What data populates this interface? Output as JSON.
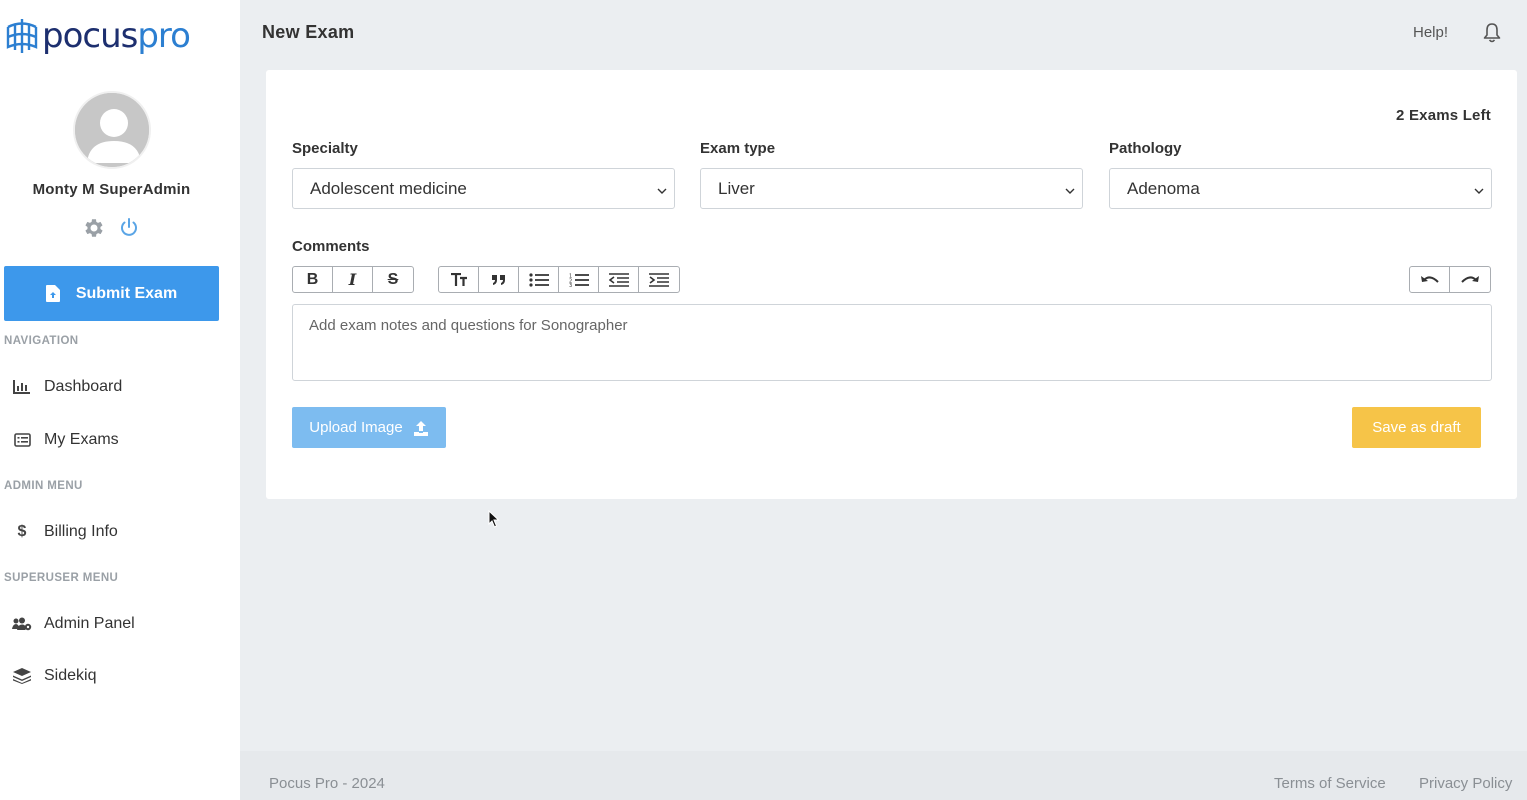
{
  "brand": {
    "logo_part1": "pocus",
    "logo_part2": "pro"
  },
  "user": {
    "name": "Monty M SuperAdmin"
  },
  "sidebar": {
    "submit_label": "Submit Exam",
    "sections": {
      "navigation": "NAVIGATION",
      "admin": "ADMIN MENU",
      "superuser": "SUPERUSER MENU"
    },
    "items": {
      "dashboard": "Dashboard",
      "my_exams": "My Exams",
      "billing": "Billing Info",
      "admin_panel": "Admin Panel",
      "sidekiq": "Sidekiq"
    }
  },
  "header": {
    "title": "New Exam",
    "help": "Help!"
  },
  "form": {
    "exams_left": "2 Exams Left",
    "specialty": {
      "label": "Specialty",
      "value": "Adolescent medicine"
    },
    "exam_type": {
      "label": "Exam type",
      "value": "Liver"
    },
    "pathology": {
      "label": "Pathology",
      "value": "Adenoma"
    },
    "comments": {
      "label": "Comments",
      "placeholder": "Add exam notes and questions for Sonographer"
    },
    "upload_label": "Upload Image",
    "draft_label": "Save as draft"
  },
  "footer": {
    "copyright": "Pocus Pro - 2024",
    "terms": "Terms of Service",
    "privacy": "Privacy Policy"
  },
  "colors": {
    "primary": "#3d98eb",
    "upload": "#7dbcf0",
    "draft": "#f6c448",
    "logo_dark": "#1d2f6f",
    "logo_light": "#2c7fd1"
  },
  "icons": [
    "logo-icon",
    "avatar-icon",
    "gear-icon",
    "power-icon",
    "file-upload-icon",
    "chart-icon",
    "list-icon",
    "dollar-icon",
    "users-cog-icon",
    "layers-icon",
    "bell-icon",
    "bold-icon",
    "italic-icon",
    "strikethrough-icon",
    "heading-icon",
    "quote-icon",
    "bullet-list-icon",
    "numbered-list-icon",
    "outdent-icon",
    "indent-icon",
    "undo-icon",
    "redo-icon",
    "upload-icon",
    "chevron-down-icon",
    "cursor-icon"
  ]
}
